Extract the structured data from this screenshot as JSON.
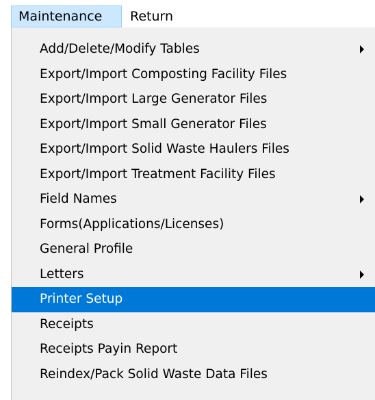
{
  "menubar": {
    "items": [
      {
        "label": "Maintenance",
        "active": true
      },
      {
        "label": "Return",
        "active": false
      }
    ]
  },
  "dropdown": {
    "highlight_color": "#0078d7",
    "items": [
      {
        "label": "Add/Delete/Modify Tables",
        "submenu": true,
        "highlighted": false
      },
      {
        "label": "Export/Import Composting Facility Files",
        "submenu": false,
        "highlighted": false
      },
      {
        "label": "Export/Import Large Generator Files",
        "submenu": false,
        "highlighted": false
      },
      {
        "label": "Export/Import Small Generator Files",
        "submenu": false,
        "highlighted": false
      },
      {
        "label": "Export/Import Solid Waste Haulers Files",
        "submenu": false,
        "highlighted": false
      },
      {
        "label": "Export/Import Treatment Facility Files",
        "submenu": false,
        "highlighted": false
      },
      {
        "label": "Field Names",
        "submenu": true,
        "highlighted": false
      },
      {
        "label": "Forms(Applications/Licenses)",
        "submenu": false,
        "highlighted": false
      },
      {
        "label": "General Profile",
        "submenu": false,
        "highlighted": false
      },
      {
        "label": "Letters",
        "submenu": true,
        "highlighted": false
      },
      {
        "label": "Printer Setup",
        "submenu": false,
        "highlighted": true
      },
      {
        "label": "Receipts",
        "submenu": false,
        "highlighted": false
      },
      {
        "label": "Receipts Payin Report",
        "submenu": false,
        "highlighted": false
      },
      {
        "label": "Reindex/Pack Solid Waste Data Files",
        "submenu": false,
        "highlighted": false
      }
    ]
  }
}
